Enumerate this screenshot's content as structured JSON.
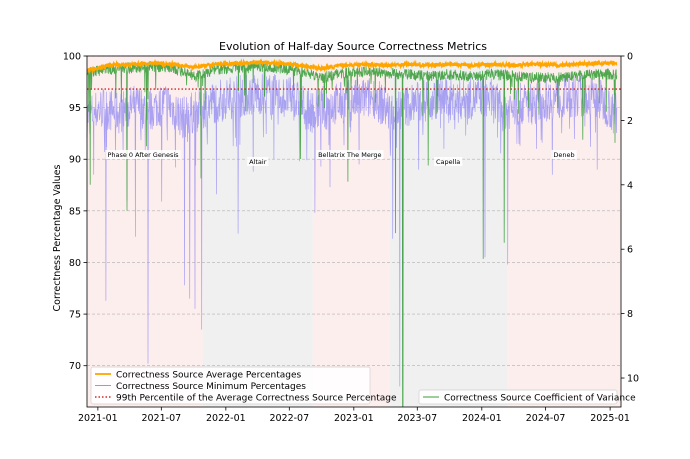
{
  "chart_data": {
    "type": "line",
    "title": "Evolution of Half-day Source Correctness Metrics",
    "ylabel": "Correctness Percentage Values",
    "ylim": [
      66,
      100
    ],
    "y2lim": [
      0,
      10.9
    ],
    "y2_inverted": true,
    "xlim": [
      "2020-12-01",
      "2025-02-01"
    ],
    "x_ticks": [
      "2021-01",
      "2021-07",
      "2022-01",
      "2022-07",
      "2023-01",
      "2023-07",
      "2024-01",
      "2024-07",
      "2025-01"
    ],
    "y_ticks": [
      70,
      75,
      80,
      85,
      90,
      95,
      100
    ],
    "y2_ticks": [
      0,
      2,
      4,
      6,
      8,
      10
    ],
    "grid": "horizontal dashed",
    "phases": [
      {
        "label": "Phase 0 After Genesis",
        "start": "2020-12-01",
        "end": "2021-10-27",
        "color": "#fdeeee"
      },
      {
        "label": "Altair",
        "start": "2021-10-27",
        "end": "2022-09-06",
        "color": "#f0f0f0"
      },
      {
        "label": "Bellatrix The Merge",
        "start": "2022-09-06",
        "end": "2023-04-12",
        "color": "#fdeeee"
      },
      {
        "label": "Capella",
        "start": "2023-04-12",
        "end": "2024-03-13",
        "color": "#f0f0f0"
      },
      {
        "label": "Deneb",
        "start": "2024-03-13",
        "end": "2025-02-01",
        "color": "#fdeeee"
      }
    ],
    "percentile_99": 96.8,
    "series": [
      {
        "name": "Correctness Source Average Percentages",
        "color": "#ffa500",
        "axis": "left",
        "x": [
          "2020-12-01",
          "2021-02-01",
          "2021-04-01",
          "2021-06-01",
          "2021-08-01",
          "2021-10-01",
          "2021-12-01",
          "2022-02-01",
          "2022-04-01",
          "2022-06-01",
          "2022-08-01",
          "2022-10-01",
          "2022-12-01",
          "2023-02-01",
          "2023-04-01",
          "2023-06-01",
          "2023-08-01",
          "2023-10-01",
          "2023-12-01",
          "2024-02-01",
          "2024-04-01",
          "2024-06-01",
          "2024-08-01",
          "2024-10-01",
          "2024-12-01",
          "2025-01-20"
        ],
        "values": [
          98.6,
          99.1,
          99.2,
          99.3,
          99.2,
          98.9,
          99.2,
          99.3,
          99.4,
          99.3,
          99.1,
          98.8,
          99.1,
          99.2,
          99.1,
          99.2,
          99.1,
          99.2,
          99.1,
          99.2,
          99.1,
          99.2,
          99.1,
          99.2,
          99.3,
          99.3
        ]
      },
      {
        "name": "Correctness Source Minimum Percentages",
        "color": "#9b93f2",
        "axis": "left",
        "x": [
          "2020-12-01",
          "2021-01-15",
          "2021-03-01",
          "2021-04-15",
          "2021-06-01",
          "2021-07-15",
          "2021-09-01",
          "2021-10-15",
          "2021-12-01",
          "2022-01-15",
          "2022-03-01",
          "2022-04-15",
          "2022-06-01",
          "2022-07-15",
          "2022-09-01",
          "2022-10-15",
          "2022-12-01",
          "2023-01-15",
          "2023-03-01",
          "2023-04-15",
          "2023-06-01",
          "2023-07-15",
          "2023-09-01",
          "2023-10-15",
          "2023-12-01",
          "2024-01-15",
          "2024-03-01",
          "2024-04-15",
          "2024-06-01",
          "2024-07-15",
          "2024-09-01",
          "2024-10-15",
          "2024-12-01",
          "2025-01-20"
        ],
        "values": [
          94.2,
          95.0,
          94.5,
          95.2,
          94.8,
          95.5,
          94.0,
          94.8,
          95.6,
          96.0,
          96.2,
          96.4,
          96.1,
          95.8,
          94.6,
          95.2,
          95.5,
          95.8,
          96.0,
          94.5,
          95.2,
          95.6,
          96.0,
          95.7,
          95.9,
          96.1,
          94.8,
          95.3,
          95.5,
          95.8,
          96.0,
          96.2,
          95.8,
          94.5
        ]
      },
      {
        "name": "Correctness Source Coefficient of Variance",
        "color": "#3c9e3c",
        "axis": "right",
        "x": [
          "2020-12-01",
          "2021-02-01",
          "2021-04-01",
          "2021-06-01",
          "2021-08-01",
          "2021-10-01",
          "2021-12-01",
          "2022-02-01",
          "2022-04-01",
          "2022-06-01",
          "2022-08-01",
          "2022-10-01",
          "2022-12-01",
          "2023-02-01",
          "2023-04-01",
          "2023-06-01",
          "2023-08-01",
          "2023-10-01",
          "2023-12-01",
          "2024-02-01",
          "2024-04-01",
          "2024-06-01",
          "2024-08-01",
          "2024-10-01",
          "2024-12-01",
          "2025-01-20"
        ],
        "values": [
          0.45,
          0.35,
          0.3,
          0.25,
          0.28,
          0.55,
          0.35,
          0.3,
          0.28,
          0.3,
          0.4,
          0.6,
          0.45,
          0.4,
          0.45,
          0.5,
          0.55,
          0.5,
          0.55,
          0.5,
          0.55,
          0.6,
          0.6,
          0.55,
          0.5,
          0.5
        ]
      }
    ],
    "spikes_min": [
      {
        "x": "2020-12-20",
        "v": 88.5
      },
      {
        "x": "2021-01-24",
        "v": 76.3
      },
      {
        "x": "2021-02-20",
        "v": 90.6
      },
      {
        "x": "2021-03-25",
        "v": 86.0
      },
      {
        "x": "2021-04-18",
        "v": 82.5
      },
      {
        "x": "2021-05-24",
        "v": 70.2
      },
      {
        "x": "2021-07-02",
        "v": 85.9
      },
      {
        "x": "2021-08-10",
        "v": 89.2
      },
      {
        "x": "2021-09-05",
        "v": 77.8
      },
      {
        "x": "2021-09-20",
        "v": 76.5
      },
      {
        "x": "2021-10-05",
        "v": 75.5
      },
      {
        "x": "2021-10-24",
        "v": 73.5
      },
      {
        "x": "2021-12-05",
        "v": 86.6
      },
      {
        "x": "2022-02-05",
        "v": 82.8
      },
      {
        "x": "2022-03-20",
        "v": 88.8
      },
      {
        "x": "2022-05-18",
        "v": 90.0
      },
      {
        "x": "2022-07-30",
        "v": 89.8
      },
      {
        "x": "2022-09-12",
        "v": 84.8
      },
      {
        "x": "2022-10-25",
        "v": 87.3
      },
      {
        "x": "2023-01-16",
        "v": 89.5
      },
      {
        "x": "2023-04-22",
        "v": 82.3
      },
      {
        "x": "2023-05-12",
        "v": 68.0
      },
      {
        "x": "2023-05-22",
        "v": 66.0
      },
      {
        "x": "2023-07-05",
        "v": 89.0
      },
      {
        "x": "2023-09-15",
        "v": 91.0
      },
      {
        "x": "2024-01-10",
        "v": 80.5
      },
      {
        "x": "2024-03-15",
        "v": 79.8
      },
      {
        "x": "2024-06-05",
        "v": 91.0
      },
      {
        "x": "2024-07-20",
        "v": 88.5
      },
      {
        "x": "2024-11-25",
        "v": 89.0
      },
      {
        "x": "2025-01-10",
        "v": 92.5
      }
    ],
    "spikes_cv": [
      {
        "x": "2020-12-10",
        "v": 4.0
      },
      {
        "x": "2021-03-25",
        "v": 4.8
      },
      {
        "x": "2021-05-20",
        "v": 2.8
      },
      {
        "x": "2021-10-22",
        "v": 3.8
      },
      {
        "x": "2022-08-02",
        "v": 3.2
      },
      {
        "x": "2022-12-15",
        "v": 3.9
      },
      {
        "x": "2023-04-30",
        "v": 5.5
      },
      {
        "x": "2023-05-20",
        "v": 10.9
      },
      {
        "x": "2023-08-01",
        "v": 3.4
      },
      {
        "x": "2024-01-05",
        "v": 6.3
      },
      {
        "x": "2024-03-05",
        "v": 5.8
      },
      {
        "x": "2024-10-15",
        "v": 2.6
      },
      {
        "x": "2025-01-15",
        "v": 2.7
      }
    ],
    "legend": {
      "left_placement": "lower-left",
      "right_placement": "lower-right",
      "left_entries": [
        "Correctness Source Average Percentages",
        "Correctness Source Minimum Percentages",
        "99th Percentile of the Average Correctness Source Percentage"
      ],
      "right_entries": [
        "Correctness Source Coefficient of Variance"
      ]
    },
    "colors": {
      "average": "#ffa500",
      "minimum": "#9b93f2",
      "percentile": "#d62728",
      "cv": "#3c9e3c"
    }
  }
}
